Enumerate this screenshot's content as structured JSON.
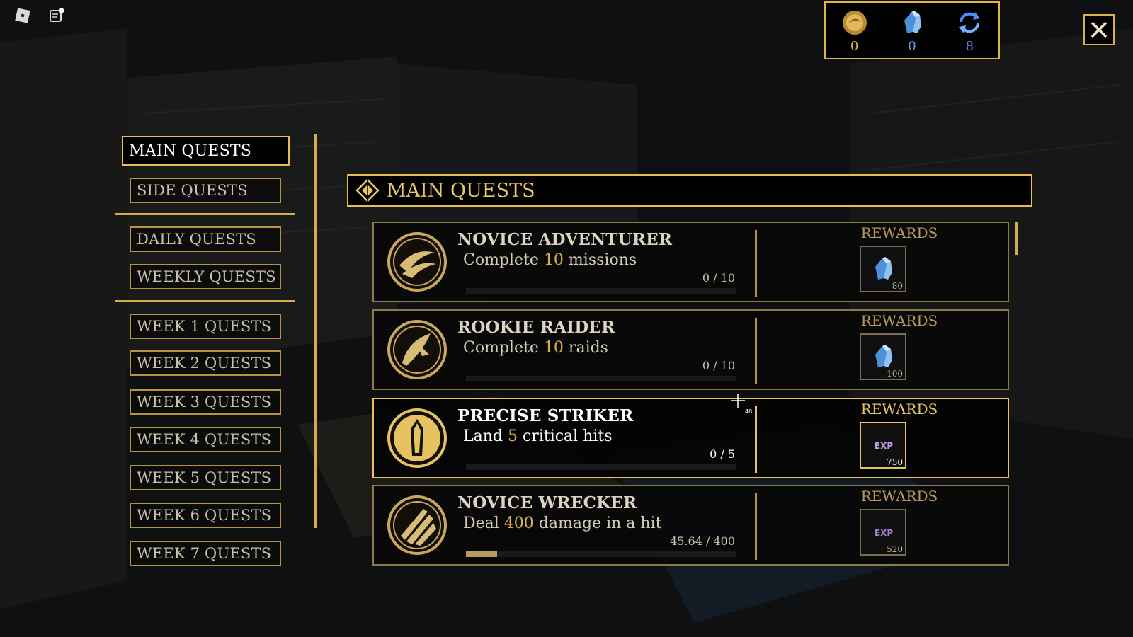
{
  "topbar": {
    "icons": [
      "roblox-icon",
      "chat-icon"
    ]
  },
  "currency": {
    "items": [
      {
        "icon": "gold-coin-icon",
        "value": "0",
        "color": "#d6ad55"
      },
      {
        "icon": "crystal-icon",
        "value": "0",
        "color": "#5aa0e8"
      },
      {
        "icon": "refresh-icon",
        "value": "8",
        "color": "#6f84ff"
      }
    ]
  },
  "close": {
    "icon": "close-icon"
  },
  "nav": {
    "main_quests": "MAIN QUESTS",
    "side_quests": "SIDE QUESTS",
    "daily_quests": "DAILY QUESTS",
    "weekly_quests": "WEEKLY QUESTS",
    "weeks": [
      "WEEK 1 QUESTS",
      "WEEK 2 QUESTS",
      "WEEK 3 QUESTS",
      "WEEK 4 QUESTS",
      "WEEK 5 QUESTS",
      "WEEK 6 QUESTS",
      "WEEK 7 QUESTS"
    ]
  },
  "panel": {
    "title": "MAIN QUESTS",
    "title_icon": "diamond-emblem-icon"
  },
  "quests": [
    {
      "name": "NOVICE ADVENTURER",
      "desc_pre": "Complete ",
      "desc_num": "10",
      "desc_post": " missions",
      "progress_text": "0 / 10",
      "progress": 0.0,
      "rewards_label": "REWARDS",
      "reward_icon": "crystal-icon",
      "reward_amount": "80",
      "emblem": "swoosh-emblem-icon"
    },
    {
      "name": "ROOKIE RAIDER",
      "desc_pre": "Complete ",
      "desc_num": "10",
      "desc_post": " raids",
      "progress_text": "0 / 10",
      "progress": 0.0,
      "rewards_label": "REWARDS",
      "reward_icon": "crystal-icon",
      "reward_amount": "100",
      "emblem": "leaf-emblem-icon"
    },
    {
      "name": "PRECISE STRIKER",
      "desc_pre": "Land ",
      "desc_num": "5",
      "desc_post": " critical hits",
      "progress_text": "0 / 5",
      "progress": 0.0,
      "rewards_label": "REWARDS",
      "reward_icon": "exp-icon",
      "reward_amount": "750",
      "emblem": "crystal-shard-emblem-icon"
    },
    {
      "name": "NOVICE WRECKER",
      "desc_pre": "Deal ",
      "desc_num": "400",
      "desc_post": " damage in a hit",
      "progress_text": "45.64 / 400",
      "progress": 0.1141,
      "rewards_label": "REWARDS",
      "reward_icon": "exp-icon",
      "reward_amount": "520",
      "emblem": "claw-emblem-icon"
    }
  ],
  "reward_icons": {
    "exp_label": "EXP"
  },
  "cursor": {
    "label": "48"
  }
}
